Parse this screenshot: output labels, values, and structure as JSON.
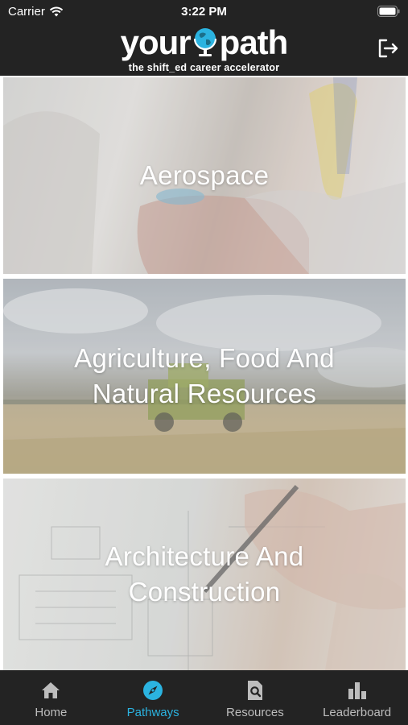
{
  "status_bar": {
    "carrier": "Carrier",
    "time": "3:22 PM"
  },
  "header": {
    "logo_left": "your",
    "logo_right": "path",
    "tagline": "the shift_ed career accelerator"
  },
  "pathways": [
    {
      "title": "Aerospace"
    },
    {
      "title_line1": "Agriculture, Food And",
      "title_line2": "Natural Resources"
    },
    {
      "title_line1": "Architecture And",
      "title_line2": "Construction"
    }
  ],
  "tabs": [
    {
      "label": "Home",
      "icon": "home-icon"
    },
    {
      "label": "Pathways",
      "icon": "compass-icon",
      "active": true
    },
    {
      "label": "Resources",
      "icon": "document-search-icon"
    },
    {
      "label": "Leaderboard",
      "icon": "bar-chart-icon"
    }
  ],
  "colors": {
    "header_bg": "#232323",
    "accent": "#2bb3e0",
    "tab_inactive": "#bdbdbd"
  }
}
